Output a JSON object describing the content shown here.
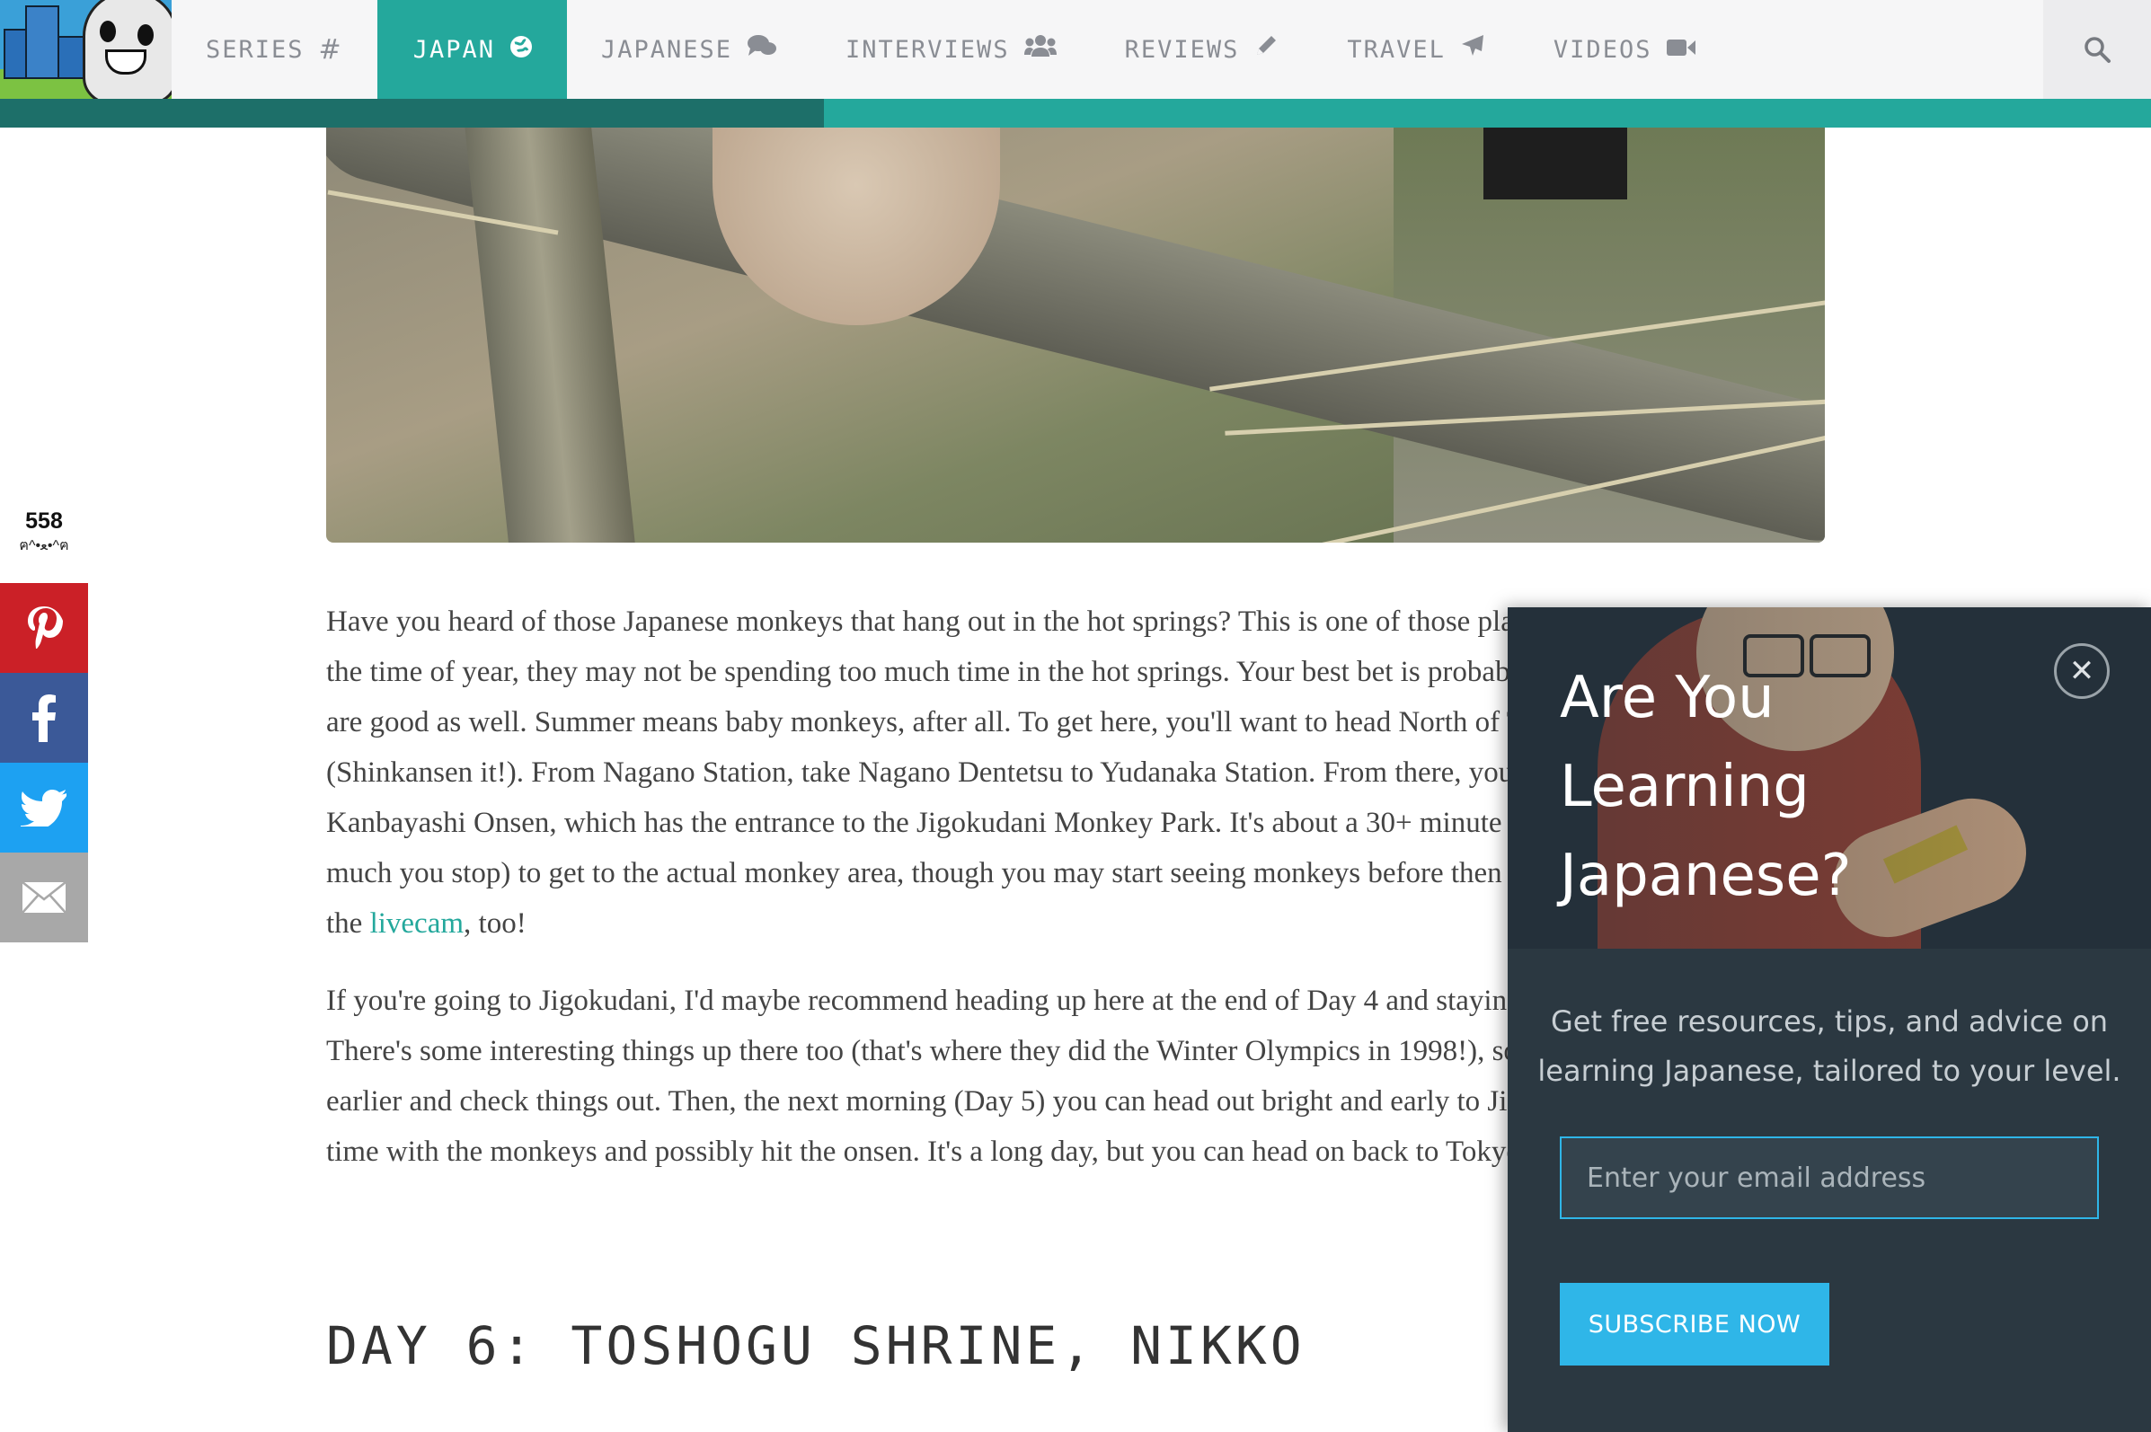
{
  "nav": {
    "items": [
      {
        "label": "SERIES",
        "icon": "hashtag-icon"
      },
      {
        "label": "JAPAN",
        "icon": "globe-icon"
      },
      {
        "label": "JAPANESE",
        "icon": "comments-icon"
      },
      {
        "label": "INTERVIEWS",
        "icon": "users-icon"
      },
      {
        "label": "REVIEWS",
        "icon": "pencil-icon"
      },
      {
        "label": "TRAVEL",
        "icon": "plane-icon"
      },
      {
        "label": "VIDEOS",
        "icon": "video-camera-icon"
      }
    ],
    "active_index": 1,
    "search_icon": "search-icon",
    "accent_color": "#24a89c",
    "reading_progress": 0.383
  },
  "share": {
    "count": "558",
    "face": "ฅ^•ﻌ•^ฅ",
    "buttons": [
      "pinterest",
      "facebook",
      "twitter",
      "email"
    ]
  },
  "article": {
    "p1_parts": {
      "before": "Have you heard of those Japanese monkeys that hang out in the hot springs? This is one of those places, though depending on the time of year, they may not be spending too much time in the hot springs. Your best bet is probably Winter, but other times are good as well. Summer means baby monkeys, after all. To get here, you'll want to head North of Tokyo to Nagano (Shinkansen it!). From Nagano Station, take Nagano Dentetsu to Yudanaka Station. From there, you can take a bus to the Kanbayashi Onsen, which has the entrance to the Jigokudani Monkey Park. It's about a 30+ minute walk (depending on how much you stop) to get to the actual monkey area, though you may start seeing monkeys before then if you're lucky. Check out the ",
      "link": "livecam",
      "after": ", too!"
    },
    "p2": "If you're going to Jigokudani, I'd maybe recommend heading up here at the end of Day 4 and staying the night in Nagano. There's some interesting things up there too (that's where they did the Winter Olympics in 1998!), so feel free to head up a bit earlier and check things out. Then, the next morning (Day 5) you can head out bright and early to Jigokudani and take your time with the monkeys and possibly hit the onsen. It's a long day, but you can head on back to Tokyo the same night.",
    "heading": "DAY 6: TOSHOGU SHRINE, NIKKO"
  },
  "popup": {
    "title": "Are You Learning Japanese?",
    "close_icon": "close-icon",
    "description": "Get free resources, tips, and advice on learning Japanese, tailored to your level.",
    "email_placeholder": "Enter your email address",
    "button_label": "SUBSCRIBE NOW"
  }
}
